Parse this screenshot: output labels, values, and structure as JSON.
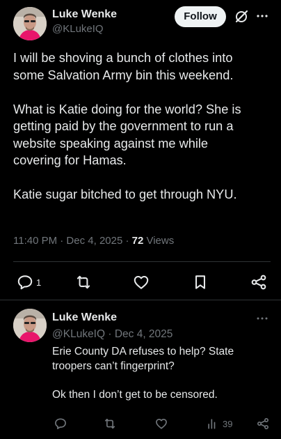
{
  "post": {
    "author_name": "Luke Wenke",
    "author_handle": "@KLukeIQ",
    "follow_label": "Follow",
    "text_lines": [
      "I will be shoving a bunch of clothes into",
      "some Salvation Army bin this weekend.",
      "",
      "What is Katie doing for the world?  She is",
      "getting paid by the government to run a",
      "website speaking against me while",
      "covering for Hamas.",
      "",
      "Katie sugar bitched to get through NYU."
    ],
    "timestamp": "11:40 PM · Dec 4, 2025 · ",
    "views_count": "72",
    "views_label": " Views",
    "reply_count": "1",
    "icons": [
      "reply-icon",
      "repost-icon",
      "like-icon",
      "bookmark-icon",
      "share-icon",
      "grok-icon",
      "more-icon"
    ]
  },
  "reply": {
    "author_name": "Luke Wenke",
    "author_handle": "@KLukeIQ",
    "separator": " · ",
    "date": "Dec 4, 2025",
    "text_lines": [
      "Erie County DA refuses to help?  State",
      "troopers can’t fingerprint?",
      "",
      "Ok then I don’t get to be censored."
    ],
    "views_count": "39",
    "icons": [
      "reply-icon",
      "repost-icon",
      "like-icon",
      "views-icon",
      "share-icon",
      "more-icon"
    ]
  },
  "colors": {
    "background": "#000000",
    "text": "#e7e9ea",
    "secondary": "#71767b",
    "divider": "#2f3336",
    "follow_bg": "#eff3f4"
  }
}
